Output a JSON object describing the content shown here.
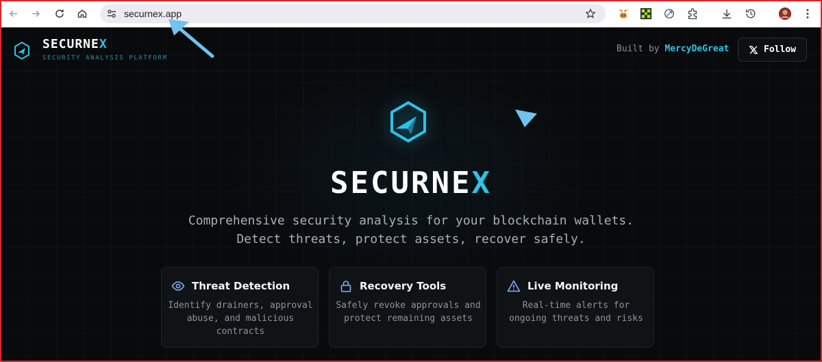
{
  "browser": {
    "url": "securnex.app",
    "extensions": [
      "metamask-fox-icon",
      "green-pixel-extension-icon",
      "rocket-extension-icon",
      "extensions-puzzle-icon"
    ]
  },
  "header": {
    "brand_prefix": "SECURNE",
    "brand_accent": "X",
    "tagline": "SECURITY ANALYSIS PLATFORM",
    "built_prefix": "Built by",
    "author": "MercyDeGreat",
    "follow_label": "Follow"
  },
  "hero": {
    "title_prefix": "SECURNE",
    "title_accent": "X",
    "subtitle": "Comprehensive security analysis for your blockchain wallets. Detect threats, protect assets, recover safely."
  },
  "features": [
    {
      "icon": "eye-icon",
      "title": "Threat Detection",
      "description": "Identify drainers, approval abuse, and malicious contracts"
    },
    {
      "icon": "lock-icon",
      "title": "Recovery Tools",
      "description": "Safely revoke approvals and protect remaining assets"
    },
    {
      "icon": "warning-triangle-icon",
      "title": "Live Monitoring",
      "description": "Real-time alerts for ongoing threats and risks"
    }
  ],
  "colors": {
    "accent": "#2cc3e6",
    "background": "#080a0c",
    "annotation_border": "#e0242a",
    "annotation_arrow": "#6fc3ee"
  }
}
